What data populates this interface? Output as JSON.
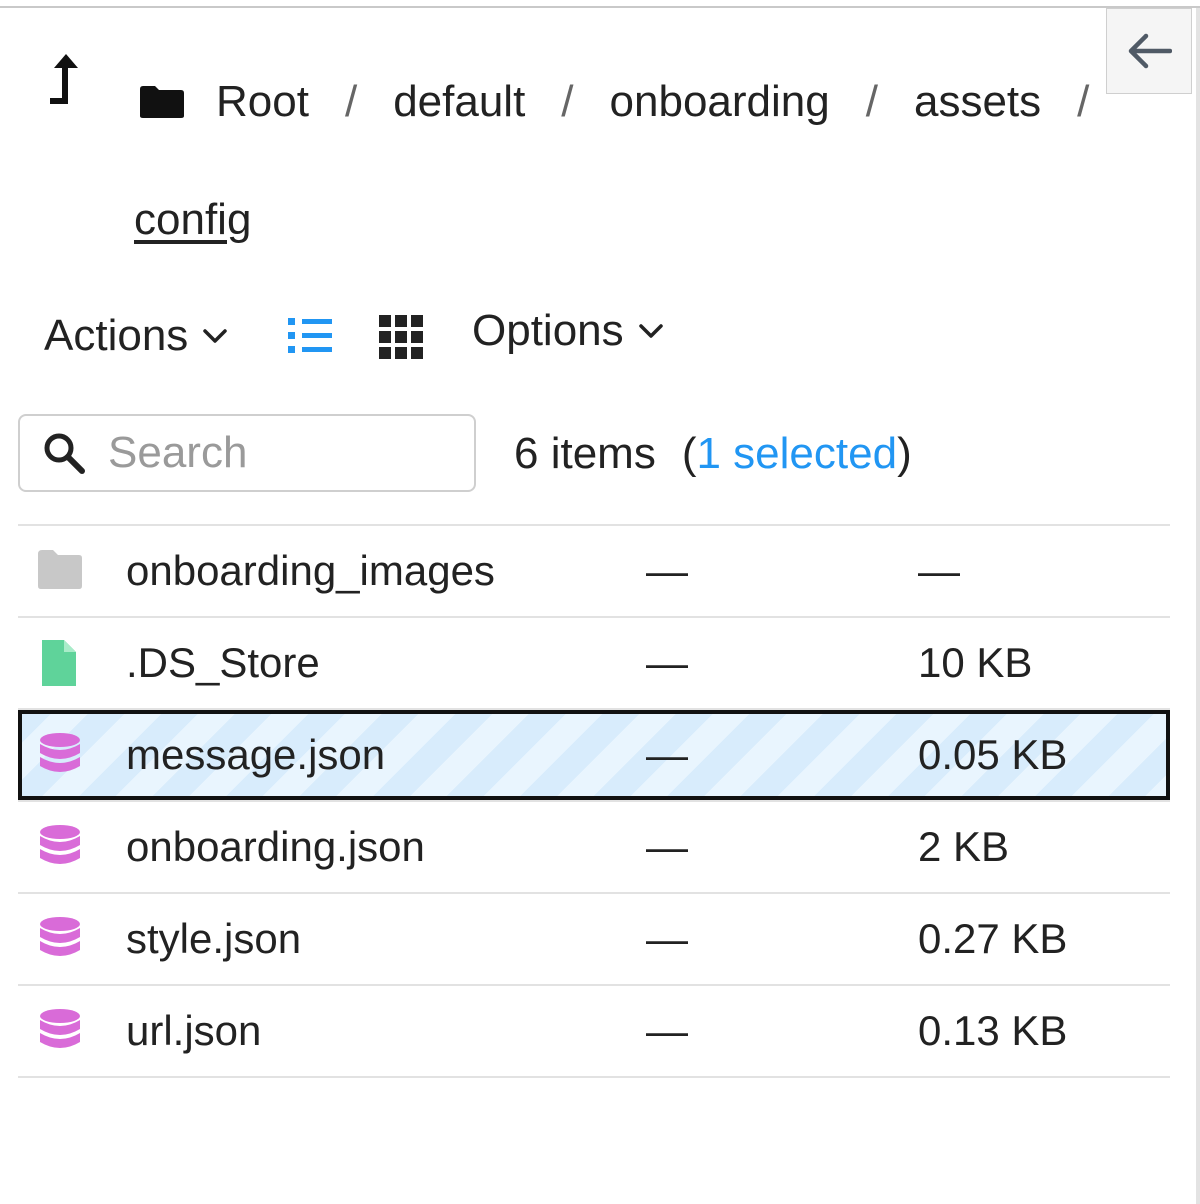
{
  "header": {
    "collapse_icon": "arrow-left-icon",
    "up_icon": "level-up-icon"
  },
  "breadcrumb": {
    "root_icon": "folder-icon",
    "items": [
      "Root",
      "default",
      "onboarding",
      "assets"
    ],
    "separator": "/",
    "current": "config"
  },
  "toolbar": {
    "actions_label": "Actions",
    "options_label": "Options",
    "list_view_icon": "list-view-icon",
    "grid_view_icon": "grid-view-icon",
    "colors": {
      "active_view": "#2196f3",
      "inactive_view": "#222222"
    }
  },
  "search": {
    "placeholder": "Search",
    "value": ""
  },
  "status": {
    "count_text": "6 items",
    "open_paren": "(",
    "selected_text": "1 selected",
    "close_paren": ")",
    "selected_color": "#2196f3"
  },
  "files": [
    {
      "name": "onboarding_images",
      "modified": "—",
      "size": "—",
      "icon": "folder-icon",
      "color": "#c8c8c8",
      "selected": false
    },
    {
      "name": ".DS_Store",
      "modified": "—",
      "size": "10 KB",
      "icon": "file-icon",
      "color": "#5fd39a",
      "selected": false
    },
    {
      "name": "message.json",
      "modified": "—",
      "size": "0.05 KB",
      "icon": "database-icon",
      "color": "#d96bd8",
      "selected": true
    },
    {
      "name": "onboarding.json",
      "modified": "—",
      "size": "2 KB",
      "icon": "database-icon",
      "color": "#d96bd8",
      "selected": false
    },
    {
      "name": "style.json",
      "modified": "—",
      "size": "0.27 KB",
      "icon": "database-icon",
      "color": "#d96bd8",
      "selected": false
    },
    {
      "name": "url.json",
      "modified": "—",
      "size": "0.13 KB",
      "icon": "database-icon",
      "color": "#d96bd8",
      "selected": false
    }
  ]
}
